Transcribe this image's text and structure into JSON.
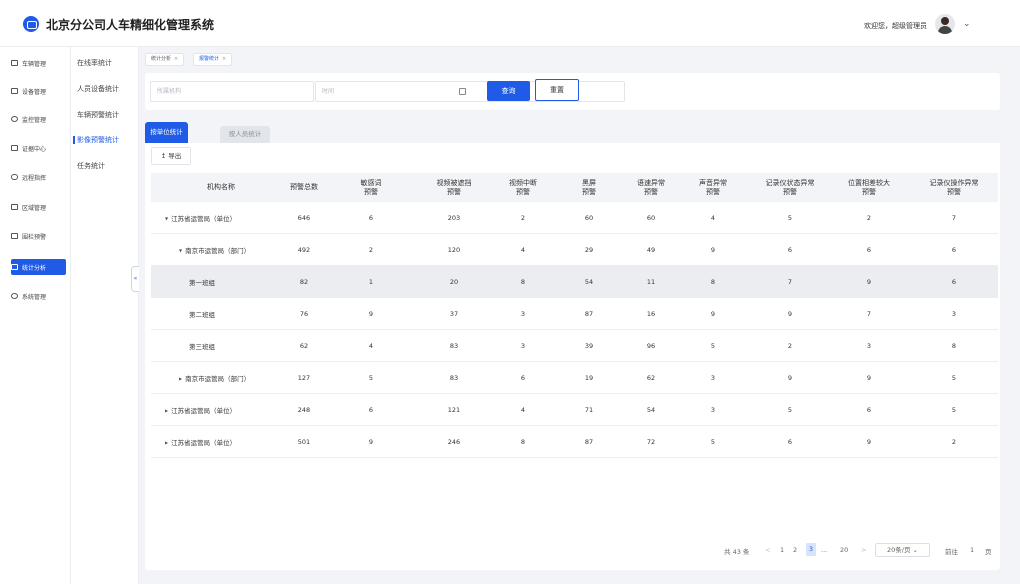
{
  "header": {
    "title": "北京分公司人车精细化管理系统",
    "welcome": "欢迎您，超级管理员"
  },
  "sidebar": {
    "items": [
      {
        "label": "车辆管理",
        "icon": "car-icon"
      },
      {
        "label": "设备管理",
        "icon": "device-icon"
      },
      {
        "label": "监控管理",
        "icon": "monitor-icon"
      },
      {
        "label": "证据中心",
        "icon": "evidence-icon"
      },
      {
        "label": "远程指挥",
        "icon": "remote-icon"
      },
      {
        "label": "区域管理",
        "icon": "area-icon"
      },
      {
        "label": "围栏预警",
        "icon": "fence-icon"
      },
      {
        "label": "统计分析",
        "icon": "stats-icon"
      },
      {
        "label": "系统管理",
        "icon": "settings-icon"
      }
    ]
  },
  "submenu": {
    "items": [
      "在线率统计",
      "人员设备统计",
      "车辆预警统计",
      "影像预警统计",
      "任务统计"
    ]
  },
  "page_tabs": [
    {
      "label": "统计分析",
      "close": "×"
    },
    {
      "label": "报警统计",
      "close": "×"
    }
  ],
  "filter": {
    "org_placeholder": "所属机构",
    "time_placeholder": "时间",
    "search_label": "查询",
    "reset_label": "重置"
  },
  "content_tabs": [
    "按单位统计",
    "按人员统计"
  ],
  "export_label": "导出",
  "table": {
    "headers": [
      "机构名称",
      "预警总数",
      "敏感词\n预警",
      "视频被遮挡\n预警",
      "视频中断\n预警",
      "黑屏\n预警",
      "语速异常\n预警",
      "声音异常\n预警",
      "记录仪状态异常\n预警",
      "位置相差较大\n预警",
      "记录仪操作异常\n预警"
    ],
    "rows": [
      {
        "caret": "▼",
        "name": "江苏省运管局（单位）",
        "cells": [
          "646",
          "6",
          "203",
          "2",
          "60",
          "60",
          "4",
          "5",
          "2",
          "7"
        ]
      },
      {
        "caret": "▼",
        "name": "南京市运管局（部门）",
        "cells": [
          "492",
          "2",
          "120",
          "4",
          "29",
          "49",
          "9",
          "6",
          "6",
          "6"
        ]
      },
      {
        "caret": "",
        "name": "第一班组",
        "cells": [
          "82",
          "1",
          "20",
          "8",
          "54",
          "11",
          "8",
          "7",
          "9",
          "6"
        ]
      },
      {
        "caret": "",
        "name": "第二班组",
        "cells": [
          "76",
          "9",
          "37",
          "3",
          "87",
          "16",
          "9",
          "9",
          "7",
          "3"
        ]
      },
      {
        "caret": "",
        "name": "第三班组",
        "cells": [
          "62",
          "4",
          "83",
          "3",
          "39",
          "96",
          "5",
          "2",
          "3",
          "8"
        ]
      },
      {
        "caret": "▶",
        "name": "南京市运管局（部门）",
        "cells": [
          "127",
          "5",
          "83",
          "6",
          "19",
          "62",
          "3",
          "9",
          "9",
          "5"
        ]
      },
      {
        "caret": "▶",
        "name": "江苏省运管局（单位）",
        "cells": [
          "248",
          "6",
          "121",
          "4",
          "71",
          "54",
          "3",
          "5",
          "6",
          "5"
        ]
      },
      {
        "caret": "▶",
        "name": "江苏省运管局（单位）",
        "cells": [
          "501",
          "9",
          "246",
          "8",
          "87",
          "72",
          "5",
          "6",
          "9",
          "2"
        ]
      }
    ]
  },
  "pagination": {
    "total": "共 43 条",
    "prev": "<",
    "pages": [
      "1",
      "2",
      "3",
      "...",
      "20"
    ],
    "current": "3",
    "next": ">",
    "page_size": "20条/页",
    "goto_prefix": "前往",
    "goto_value": "1",
    "goto_suffix": "页"
  },
  "colors": {
    "accent": "#1f5be6"
  }
}
